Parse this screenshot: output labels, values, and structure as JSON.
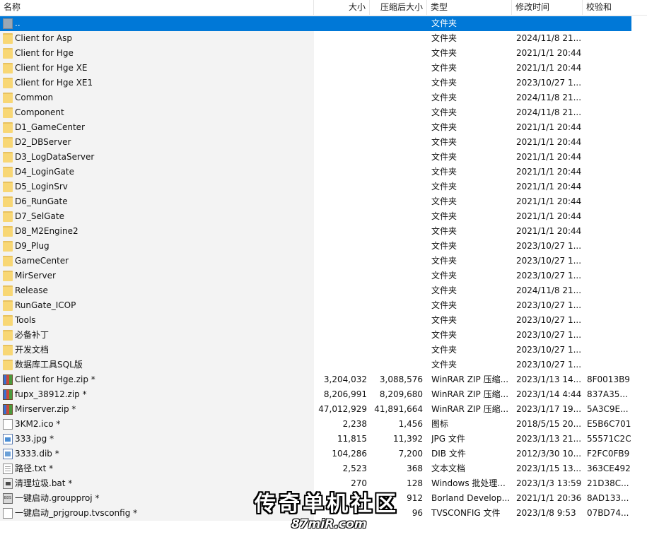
{
  "columns": {
    "name": "名称",
    "size": "大小",
    "packed": "压缩后大小",
    "type": "类型",
    "mtime": "修改时间",
    "crc": "校验和"
  },
  "rows": [
    {
      "icon": "up-icon",
      "name": "..",
      "size": "",
      "packed": "",
      "type": "文件夹",
      "mtime": "",
      "crc": "",
      "selected": true
    },
    {
      "icon": "folder-icon",
      "name": "Client for Asp",
      "size": "",
      "packed": "",
      "type": "文件夹",
      "mtime": "2024/11/8 21...",
      "crc": ""
    },
    {
      "icon": "folder-icon",
      "name": "Client for Hge",
      "size": "",
      "packed": "",
      "type": "文件夹",
      "mtime": "2021/1/1 20:44",
      "crc": ""
    },
    {
      "icon": "folder-icon",
      "name": "Client for Hge XE",
      "size": "",
      "packed": "",
      "type": "文件夹",
      "mtime": "2021/1/1 20:44",
      "crc": ""
    },
    {
      "icon": "folder-icon",
      "name": "Client for Hge XE1",
      "size": "",
      "packed": "",
      "type": "文件夹",
      "mtime": "2023/10/27 1...",
      "crc": ""
    },
    {
      "icon": "folder-icon",
      "name": "Common",
      "size": "",
      "packed": "",
      "type": "文件夹",
      "mtime": "2024/11/8 21...",
      "crc": ""
    },
    {
      "icon": "folder-icon",
      "name": "Component",
      "size": "",
      "packed": "",
      "type": "文件夹",
      "mtime": "2024/11/8 21...",
      "crc": ""
    },
    {
      "icon": "folder-icon",
      "name": "D1_GameCenter",
      "size": "",
      "packed": "",
      "type": "文件夹",
      "mtime": "2021/1/1 20:44",
      "crc": ""
    },
    {
      "icon": "folder-icon",
      "name": "D2_DBServer",
      "size": "",
      "packed": "",
      "type": "文件夹",
      "mtime": "2021/1/1 20:44",
      "crc": ""
    },
    {
      "icon": "folder-icon",
      "name": "D3_LogDataServer",
      "size": "",
      "packed": "",
      "type": "文件夹",
      "mtime": "2021/1/1 20:44",
      "crc": ""
    },
    {
      "icon": "folder-icon",
      "name": "D4_LoginGate",
      "size": "",
      "packed": "",
      "type": "文件夹",
      "mtime": "2021/1/1 20:44",
      "crc": ""
    },
    {
      "icon": "folder-icon",
      "name": "D5_LoginSrv",
      "size": "",
      "packed": "",
      "type": "文件夹",
      "mtime": "2021/1/1 20:44",
      "crc": ""
    },
    {
      "icon": "folder-icon",
      "name": "D6_RunGate",
      "size": "",
      "packed": "",
      "type": "文件夹",
      "mtime": "2021/1/1 20:44",
      "crc": ""
    },
    {
      "icon": "folder-icon",
      "name": "D7_SelGate",
      "size": "",
      "packed": "",
      "type": "文件夹",
      "mtime": "2021/1/1 20:44",
      "crc": ""
    },
    {
      "icon": "folder-icon",
      "name": "D8_M2Engine2",
      "size": "",
      "packed": "",
      "type": "文件夹",
      "mtime": "2021/1/1 20:44",
      "crc": ""
    },
    {
      "icon": "folder-icon",
      "name": "D9_Plug",
      "size": "",
      "packed": "",
      "type": "文件夹",
      "mtime": "2023/10/27 1...",
      "crc": ""
    },
    {
      "icon": "folder-icon",
      "name": "GameCenter",
      "size": "",
      "packed": "",
      "type": "文件夹",
      "mtime": "2023/10/27 1...",
      "crc": ""
    },
    {
      "icon": "folder-icon",
      "name": "MirServer",
      "size": "",
      "packed": "",
      "type": "文件夹",
      "mtime": "2023/10/27 1...",
      "crc": ""
    },
    {
      "icon": "folder-icon",
      "name": "Release",
      "size": "",
      "packed": "",
      "type": "文件夹",
      "mtime": "2024/11/8 21...",
      "crc": ""
    },
    {
      "icon": "folder-icon",
      "name": "RunGate_ICOP",
      "size": "",
      "packed": "",
      "type": "文件夹",
      "mtime": "2023/10/27 1...",
      "crc": ""
    },
    {
      "icon": "folder-icon",
      "name": "Tools",
      "size": "",
      "packed": "",
      "type": "文件夹",
      "mtime": "2023/10/27 1...",
      "crc": ""
    },
    {
      "icon": "folder-icon",
      "name": "必备补丁",
      "size": "",
      "packed": "",
      "type": "文件夹",
      "mtime": "2023/10/27 1...",
      "crc": ""
    },
    {
      "icon": "folder-icon",
      "name": "开发文档",
      "size": "",
      "packed": "",
      "type": "文件夹",
      "mtime": "2023/10/27 1...",
      "crc": ""
    },
    {
      "icon": "folder-icon",
      "name": "数据库工具SQL版",
      "size": "",
      "packed": "",
      "type": "文件夹",
      "mtime": "2023/10/27 1...",
      "crc": ""
    },
    {
      "icon": "zip-icon",
      "name": "Client for Hge.zip *",
      "size": "3,204,032",
      "packed": "3,088,576",
      "type": "WinRAR ZIP 压缩...",
      "mtime": "2023/1/13 14...",
      "crc": "8F0013B9"
    },
    {
      "icon": "zip-icon",
      "name": "fupx_38912.zip *",
      "size": "8,206,991",
      "packed": "8,209,680",
      "type": "WinRAR ZIP 压缩...",
      "mtime": "2023/1/14 4:44",
      "crc": "837A35..."
    },
    {
      "icon": "zip-icon",
      "name": "Mirserver.zip *",
      "size": "47,012,929",
      "packed": "41,891,664",
      "type": "WinRAR ZIP 压缩...",
      "mtime": "2023/1/17 19...",
      "crc": "5A3C9E..."
    },
    {
      "icon": "ico-icon",
      "name": "3KM2.ico *",
      "size": "2,238",
      "packed": "1,456",
      "type": "图标",
      "mtime": "2018/5/15 20...",
      "crc": "E5B6C701"
    },
    {
      "icon": "jpg-icon",
      "name": "333.jpg *",
      "size": "11,815",
      "packed": "11,392",
      "type": "JPG 文件",
      "mtime": "2023/1/13 21...",
      "crc": "55571C2C"
    },
    {
      "icon": "dib-icon",
      "name": "3333.dib *",
      "size": "104,286",
      "packed": "7,200",
      "type": "DIB 文件",
      "mtime": "2012/3/30 10...",
      "crc": "F2FC0FB9"
    },
    {
      "icon": "txt-icon",
      "name": "路径.txt *",
      "size": "2,523",
      "packed": "368",
      "type": "文本文档",
      "mtime": "2023/1/15 13...",
      "crc": "363CE492"
    },
    {
      "icon": "bat-icon",
      "name": "清理垃圾.bat *",
      "size": "270",
      "packed": "128",
      "type": "Windows 批处理...",
      "mtime": "2023/1/3 13:59",
      "crc": "21D38C..."
    },
    {
      "icon": "bds-icon",
      "name": "一键启动.groupproj *",
      "size": "",
      "packed": "912",
      "type": "Borland Develop...",
      "mtime": "2021/1/1 20:36",
      "crc": "8AD133..."
    },
    {
      "icon": "file-icon",
      "name": "一键启动_prjgroup.tvsconfig *",
      "size": "",
      "packed": "96",
      "type": "TVSCONFIG 文件",
      "mtime": "2023/1/8 9:53",
      "crc": "07BD74..."
    }
  ],
  "watermark": {
    "main": "传奇单机社区",
    "sub": "87miR.com"
  }
}
